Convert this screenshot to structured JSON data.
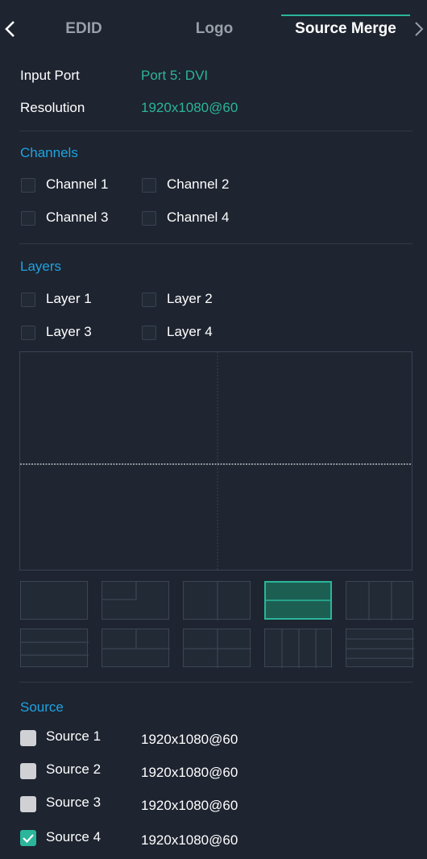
{
  "tabs": [
    {
      "label": "EDID"
    },
    {
      "label": "Logo"
    },
    {
      "label": "Source Merge"
    }
  ],
  "active_tab": "Source Merge",
  "input_port": {
    "label": "Input Port",
    "value": "Port 5: DVI"
  },
  "resolution": {
    "label": "Resolution",
    "value": "1920x1080@60"
  },
  "channels": {
    "title": "Channels",
    "items": [
      {
        "label": "Channel 1",
        "checked": false
      },
      {
        "label": "Channel 2",
        "checked": false
      },
      {
        "label": "Channel 3",
        "checked": false
      },
      {
        "label": "Channel 4",
        "checked": false
      }
    ]
  },
  "layers": {
    "title": "Layers",
    "items": [
      {
        "label": "Layer 1",
        "checked": false
      },
      {
        "label": "Layer 2",
        "checked": false
      },
      {
        "label": "Layer 3",
        "checked": false
      },
      {
        "label": "Layer 4",
        "checked": false
      }
    ]
  },
  "layout_presets": {
    "selected_index": 3,
    "count": 10
  },
  "source": {
    "title": "Source",
    "items": [
      {
        "label": "Source 1",
        "resolution": "1920x1080@60",
        "checked": false
      },
      {
        "label": "Source 2",
        "resolution": "1920x1080@60",
        "checked": false
      },
      {
        "label": "Source 3",
        "resolution": "1920x1080@60",
        "checked": false
      },
      {
        "label": "Source 4",
        "resolution": "1920x1080@60",
        "checked": true
      }
    ]
  },
  "colors": {
    "background": "#1e2430",
    "accent": "#2bb59a",
    "section_title": "#1fa3e0"
  }
}
